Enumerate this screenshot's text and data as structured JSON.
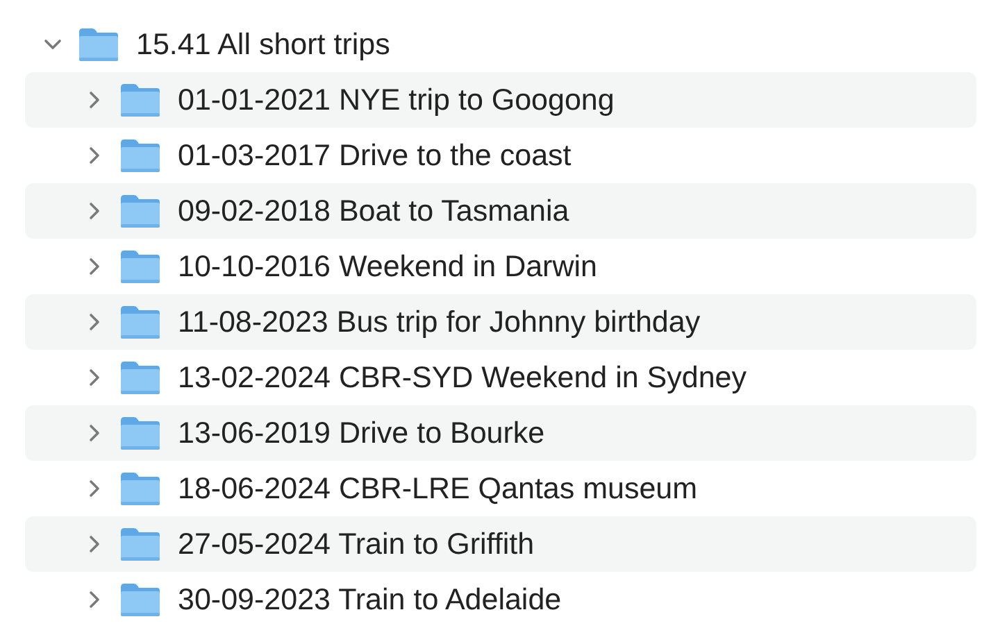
{
  "tree": [
    {
      "label": "15.41 All short trips",
      "expanded": true,
      "children": [
        {
          "label": "01-01-2021 NYE trip to Googong",
          "expanded": false
        },
        {
          "label": "01-03-2017 Drive to the coast",
          "expanded": false
        },
        {
          "label": "09-02-2018 Boat to Tasmania",
          "expanded": false
        },
        {
          "label": "10-10-2016 Weekend in Darwin",
          "expanded": false
        },
        {
          "label": "11-08-2023 Bus trip for Johnny birthday",
          "expanded": false
        },
        {
          "label": "13-02-2024 CBR-SYD Weekend in Sydney",
          "expanded": false
        },
        {
          "label": "13-06-2019 Drive to Bourke",
          "expanded": false
        },
        {
          "label": "18-06-2024 CBR-LRE Qantas museum",
          "expanded": false
        },
        {
          "label": "27-05-2024 Train to Griffith",
          "expanded": false
        },
        {
          "label": "30-09-2023 Train to Adelaide",
          "expanded": false
        }
      ]
    }
  ]
}
